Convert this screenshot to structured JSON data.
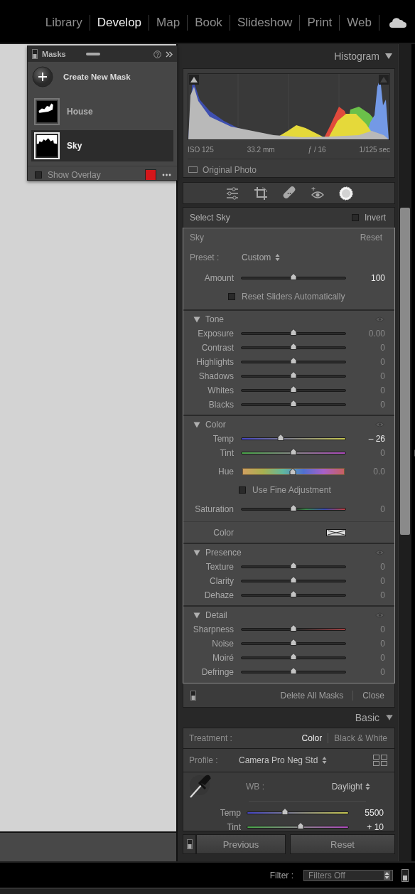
{
  "modules": [
    {
      "label": "Library",
      "selected": false
    },
    {
      "label": "Develop",
      "selected": true
    },
    {
      "label": "Map",
      "selected": false
    },
    {
      "label": "Book",
      "selected": false
    },
    {
      "label": "Slideshow",
      "selected": false
    },
    {
      "label": "Print",
      "selected": false
    },
    {
      "label": "Web",
      "selected": false
    }
  ],
  "masks_panel": {
    "switch_on": true,
    "title": "Masks",
    "create_label": "Create New Mask",
    "masks": [
      {
        "name": "House",
        "selected": false
      },
      {
        "name": "Sky",
        "selected": true
      }
    ],
    "show_overlay": {
      "label": "Show Overlay",
      "checked": false
    },
    "overlay_swatch": {
      "color": "#d4161a"
    }
  },
  "histogram": {
    "title": "Histogram",
    "info": [
      "ISO 125",
      "33.2 mm",
      "ƒ / 16",
      "1/125 sec"
    ],
    "original_photo": {
      "label": "Original Photo",
      "checked": false
    }
  },
  "tools": [
    {
      "kind": "sliders",
      "selected": false
    },
    {
      "kind": "crop",
      "selected": false
    },
    {
      "kind": "heal",
      "selected": false
    },
    {
      "kind": "redeye",
      "selected": false
    },
    {
      "kind": "mask",
      "selected": true
    }
  ],
  "mask_editor": {
    "selection": "Select Sky",
    "invert": {
      "label": "Invert",
      "checked": false
    },
    "mask_name": "Sky",
    "reset": "Reset",
    "preset_label": "Preset :",
    "preset_value": "Custom",
    "amount": {
      "label": "Amount",
      "level": 0.5,
      "value": "100",
      "changed": true
    },
    "reset_sliders": {
      "label": "Reset Sliders Automatically",
      "checked": false
    },
    "sections": [
      {
        "title": "Tone",
        "expanded": true,
        "items": [
          {
            "kind": "plain",
            "label": "Exposure",
            "level": 0.5,
            "value": "0.00",
            "changed": false
          },
          {
            "kind": "plain",
            "label": "Contrast",
            "level": 0.5,
            "value": "0",
            "changed": false
          },
          {
            "kind": "plain",
            "label": "Highlights",
            "level": 0.5,
            "value": "0",
            "changed": false
          },
          {
            "kind": "plain",
            "label": "Shadows",
            "level": 0.5,
            "value": "0",
            "changed": false
          },
          {
            "kind": "plain",
            "label": "Whites",
            "level": 0.5,
            "value": "0",
            "changed": false
          },
          {
            "kind": "plain",
            "label": "Blacks",
            "level": 0.5,
            "value": "0",
            "changed": false
          }
        ]
      },
      {
        "title": "Color",
        "expanded": true,
        "items": [
          {
            "kind": "temp",
            "label": "Temp",
            "level": 0.38,
            "value": "– 26",
            "changed": true
          },
          {
            "kind": "tint",
            "label": "Tint",
            "level": 0.5,
            "value": "0",
            "changed": false
          },
          {
            "kind": "hue",
            "label": "Hue",
            "level": 0.49,
            "value": "0.0",
            "changed": false
          },
          {
            "kind": "checkbox",
            "label": "Use Fine Adjustment",
            "checked": false
          },
          {
            "kind": "saturation",
            "label": "Saturation",
            "level": 0.5,
            "value": "0",
            "changed": false
          },
          {
            "kind": "swatch",
            "label": "Color"
          }
        ]
      },
      {
        "title": "Presence",
        "expanded": true,
        "items": [
          {
            "kind": "plain",
            "label": "Texture",
            "level": 0.5,
            "value": "0",
            "changed": false
          },
          {
            "kind": "plain",
            "label": "Clarity",
            "level": 0.5,
            "value": "0",
            "changed": false
          },
          {
            "kind": "plain",
            "label": "Dehaze",
            "level": 0.5,
            "value": "0",
            "changed": false
          }
        ]
      },
      {
        "title": "Detail",
        "expanded": true,
        "items": [
          {
            "kind": "sharpness",
            "label": "Sharpness",
            "level": 0.5,
            "value": "0",
            "changed": false
          },
          {
            "kind": "plain",
            "label": "Noise",
            "level": 0.5,
            "value": "0",
            "changed": false
          },
          {
            "kind": "plain",
            "label": "Moiré",
            "level": 0.5,
            "value": "0",
            "changed": false
          },
          {
            "kind": "plain",
            "label": "Defringe",
            "level": 0.5,
            "value": "0",
            "changed": false
          }
        ]
      }
    ],
    "switch_on": true,
    "delete_all": "Delete All Masks",
    "close": "Close"
  },
  "basic": {
    "title": "Basic",
    "treatment_label": "Treatment :",
    "treatments": [
      {
        "label": "Color",
        "selected": true
      },
      {
        "label": "Black & White",
        "selected": false
      }
    ],
    "profile_label": "Profile :",
    "profile": "Camera Pro Neg Std",
    "wb_label": "WB :",
    "wb_value": "Daylight",
    "sliders": [
      {
        "kind": "temp",
        "label": "Temp",
        "level": 0.37,
        "value": "5500",
        "changed": true
      },
      {
        "kind": "tint",
        "label": "Tint",
        "level": 0.53,
        "value": "+ 10",
        "changed": true
      }
    ]
  },
  "buttons_switch_on": true,
  "buttons": [
    "Previous",
    "Reset"
  ],
  "filter": {
    "label": "Filter :",
    "value": "Filters Off",
    "switch_on": true
  }
}
